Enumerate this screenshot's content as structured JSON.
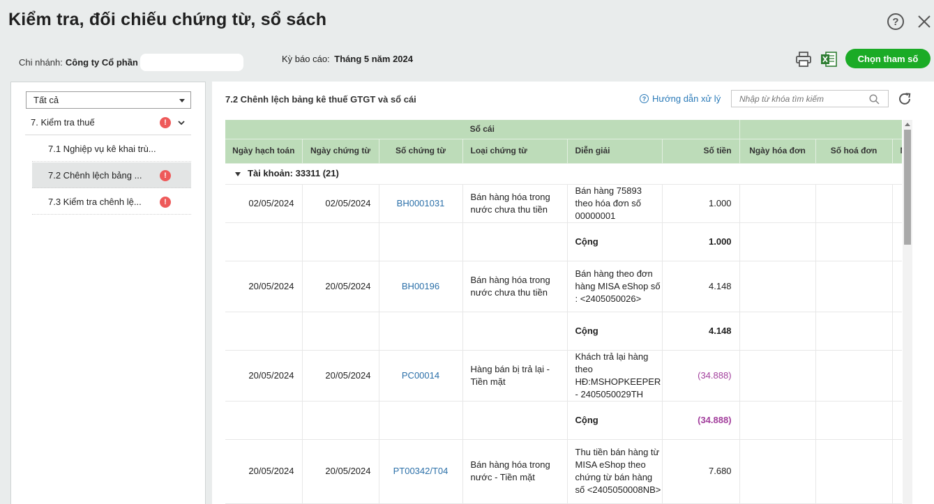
{
  "header": {
    "title": "Kiểm tra, đối chiếu chứng từ, sổ sách",
    "help_label": "?",
    "branch_label": "Chi nhánh:",
    "branch_value": "Công ty Cổ phần",
    "period_label": "Kỳ báo cáo:",
    "period_value": "Tháng 5 năm 2024",
    "choose_params_label": "Chọn tham số"
  },
  "sidebar": {
    "filter_value": "Tất cả",
    "group": {
      "label": "7. Kiểm tra thuế",
      "warn": "!"
    },
    "items": [
      {
        "label": "7.1 Nghiệp vụ kê khai trù..."
      },
      {
        "label": "7.2 Chênh lệch bảng ...",
        "warn": "!"
      },
      {
        "label": "7.3 Kiểm tra chênh lệ...",
        "warn": "!"
      }
    ]
  },
  "main": {
    "title": "7.2 Chênh lệch bảng kê thuế GTGT và sổ cái",
    "guide_label": "Hướng dẫn xử lý",
    "search_placeholder": "Nhập từ khóa tìm kiếm",
    "table": {
      "group_header": "Sổ cái",
      "columns": [
        "Ngày hạch toán",
        "Ngày chứng từ",
        "Số chứng từ",
        "Loại chứng từ",
        "Diễn giải",
        "Số tiền",
        "Ngày hóa đơn",
        "Số hoá đơn",
        "N"
      ],
      "account_group": "Tài khoản: 33311",
      "account_count": "(21)",
      "rows": [
        {
          "post_date": "02/05/2024",
          "doc_date": "02/05/2024",
          "doc_no": "BH0001031",
          "doc_type": "Bán hàng hóa trong nước chưa thu tiền",
          "desc": "Bán hàng 75893 theo hóa đơn số 00000001",
          "amount": "1.000",
          "subtotal_label": "Cộng",
          "subtotal": "1.000"
        },
        {
          "post_date": "20/05/2024",
          "doc_date": "20/05/2024",
          "doc_no": "BH00196",
          "doc_type": "Bán hàng hóa trong nước chưa thu tiền",
          "desc": "Bán hàng theo đơn hàng MISA eShop số : <2405050026>",
          "amount": "4.148",
          "subtotal_label": "Cộng",
          "subtotal": "4.148"
        },
        {
          "post_date": "20/05/2024",
          "doc_date": "20/05/2024",
          "doc_no": "PC00014",
          "doc_type": "Hàng bán bị trả lại - Tiền mặt",
          "desc": "Khách trả lại hàng theo HĐ:MSHOPKEEPER - 2405050029TH",
          "amount": "(34.888)",
          "subtotal_label": "Cộng",
          "subtotal": "(34.888)"
        },
        {
          "post_date": "20/05/2024",
          "doc_date": "20/05/2024",
          "doc_no": "PT00342/T04",
          "doc_type": "Bán hàng hóa trong nước - Tiền mặt",
          "desc": "Thu tiền bán hàng từ MISA eShop theo chứng từ bán hàng số <2405050008NB>",
          "amount": "7.680"
        }
      ]
    }
  },
  "colors": {
    "accent_green": "#1bab26",
    "header_green": "#bddcb9",
    "link_blue": "#2a6fa8",
    "negative_purple": "#a23e9c",
    "warn_red": "#ee5a5a"
  }
}
